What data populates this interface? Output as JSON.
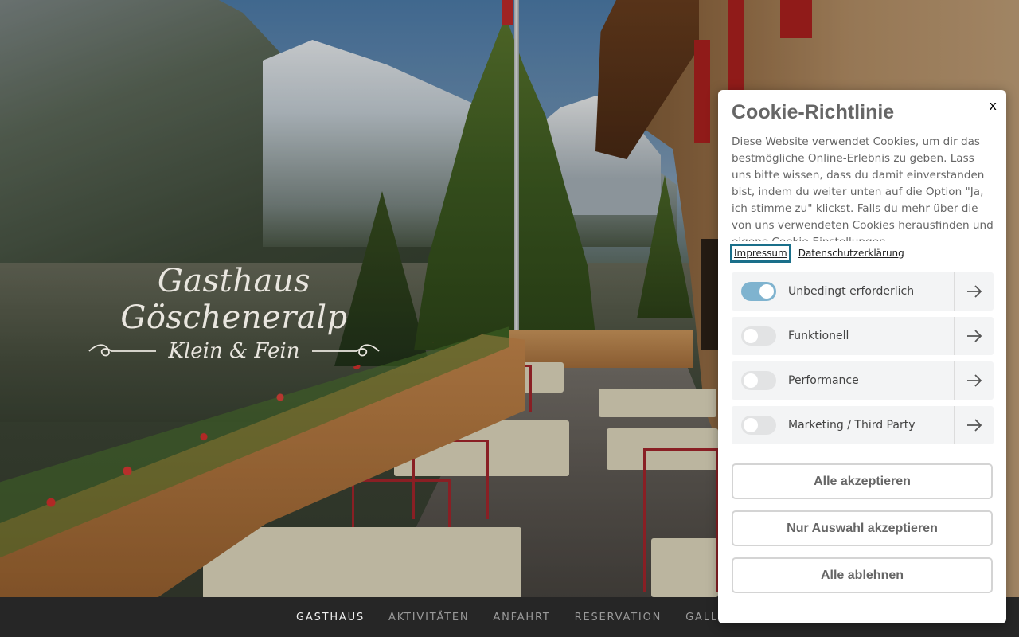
{
  "brand": {
    "title": "Gasthaus Göscheneralp",
    "subtitle": "Klein & Fein"
  },
  "nav": {
    "items": [
      {
        "label": "GASTHAUS",
        "active": true
      },
      {
        "label": "AKTIVITÄTEN",
        "active": false
      },
      {
        "label": "ANFAHRT",
        "active": false
      },
      {
        "label": "RESERVATION",
        "active": false
      },
      {
        "label": "GALLERIE",
        "active": false
      }
    ]
  },
  "cookie": {
    "close_label": "x",
    "title": "Cookie-Richtlinie",
    "text": "Diese Website verwendet Cookies, um dir das bestmögliche Online-Erlebnis zu geben. Lass uns bitte wissen, dass du damit einverstanden bist, indem du weiter unten auf die Option \"Ja, ich stimme zu\" klickst. Falls du mehr über die von uns verwendeten Cookies herausfinden und eigene Cookie-Einstellungen",
    "links": {
      "impressum": "Impressum",
      "privacy": "Datenschutzerklärung"
    },
    "categories": [
      {
        "label": "Unbedingt erforderlich",
        "enabled": true
      },
      {
        "label": "Funktionell",
        "enabled": false
      },
      {
        "label": "Performance",
        "enabled": false
      },
      {
        "label": "Marketing / Third Party",
        "enabled": false
      }
    ],
    "buttons": {
      "accept_all": "Alle akzeptieren",
      "accept_selection": "Nur Auswahl akzeptieren",
      "reject_all": "Alle ablehnen"
    }
  },
  "colors": {
    "toggle_on": "#7fb3cf",
    "focus_outline": "#1a6f8a",
    "nav_background": "#262626"
  },
  "icons": {
    "category_arrow": "arrow-right-icon",
    "close": "close-icon"
  }
}
